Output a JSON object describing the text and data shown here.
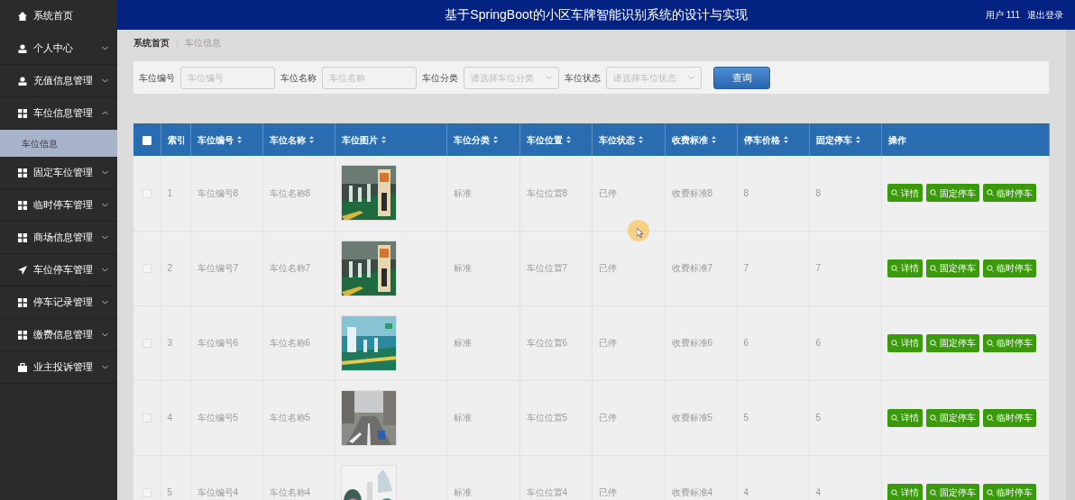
{
  "sidebar": {
    "items": [
      {
        "label": "系统首页"
      },
      {
        "label": "个人中心",
        "expanded": false
      },
      {
        "label": "充值信息管理",
        "expanded": false
      },
      {
        "label": "车位信息管理",
        "expanded": true,
        "children": [
          {
            "label": "车位信息",
            "selected": true
          }
        ]
      },
      {
        "label": "固定车位管理",
        "expanded": false
      },
      {
        "label": "临时停车管理",
        "expanded": false
      },
      {
        "label": "商场信息管理",
        "expanded": false
      },
      {
        "label": "车位停车管理",
        "expanded": false
      },
      {
        "label": "停车记录管理",
        "expanded": false
      },
      {
        "label": "缴费信息管理",
        "expanded": false
      },
      {
        "label": "业主投诉管理",
        "expanded": false
      }
    ]
  },
  "header": {
    "title": "基于SpringBoot的小区车牌智能识别系统的设计与实现",
    "user": "用户 111",
    "logout": "退出登录"
  },
  "breadcrumb": [
    "系统首页",
    "车位信息"
  ],
  "search": {
    "fields": [
      {
        "label": "车位编号",
        "kind": "input",
        "placeholder": "车位编号"
      },
      {
        "label": "车位名称",
        "kind": "input",
        "placeholder": "车位名称"
      },
      {
        "label": "车位分类",
        "kind": "select",
        "placeholder": "请选择车位分类"
      },
      {
        "label": "车位状态",
        "kind": "select",
        "placeholder": "请选择车位状态"
      }
    ],
    "button": "查询"
  },
  "table": {
    "select_all": {
      "checked": false
    },
    "columns": [
      {
        "label": "索引",
        "sortable": false
      },
      {
        "label": "车位编号",
        "sortable": true
      },
      {
        "label": "车位名称",
        "sortable": true
      },
      {
        "label": "车位图片",
        "sortable": true
      },
      {
        "label": "车位分类",
        "sortable": true
      },
      {
        "label": "车位位置",
        "sortable": true
      },
      {
        "label": "车位状态",
        "sortable": true
      },
      {
        "label": "收费标准",
        "sortable": true
      },
      {
        "label": "停车价格",
        "sortable": true
      },
      {
        "label": "固定停车",
        "sortable": true
      },
      {
        "label": "操作",
        "sortable": false
      }
    ],
    "rows": [
      {
        "checked": false,
        "cells": [
          "1",
          "车位编号8",
          "车位名称8",
          {
            "kind": "picture"
          },
          "标准",
          "车位位置8",
          "已停",
          "收费标准8",
          "8",
          "8"
        ],
        "actions": [
          "详情",
          "固定停车",
          "临时停车"
        ]
      },
      {
        "checked": false,
        "cells": [
          "2",
          "车位编号7",
          "车位名称7",
          {
            "kind": "picture"
          },
          "标准",
          "车位位置7",
          "已停",
          "收费标准7",
          "7",
          "7"
        ],
        "actions": [
          "详情",
          "固定停车",
          "临时停车"
        ]
      },
      {
        "checked": false,
        "cells": [
          "3",
          "车位编号6",
          "车位名称6",
          {
            "kind": "picture"
          },
          "标准",
          "车位位置6",
          "已停",
          "收费标准6",
          "6",
          "6"
        ],
        "actions": [
          "详情",
          "固定停车",
          "临时停车"
        ]
      },
      {
        "checked": false,
        "cells": [
          "4",
          "车位编号5",
          "车位名称5",
          {
            "kind": "picture"
          },
          "标准",
          "车位位置5",
          "已停",
          "收费标准5",
          "5",
          "5"
        ],
        "actions": [
          "详情",
          "固定停车",
          "临时停车"
        ]
      },
      {
        "checked": false,
        "cells": [
          "5",
          "车位编号4",
          "车位名称4",
          {
            "kind": "picture"
          },
          "标准",
          "车位位置4",
          "已停",
          "收费标准4",
          "4",
          "4"
        ],
        "actions": [
          "详情",
          "固定停车",
          "临时停车"
        ]
      }
    ]
  }
}
